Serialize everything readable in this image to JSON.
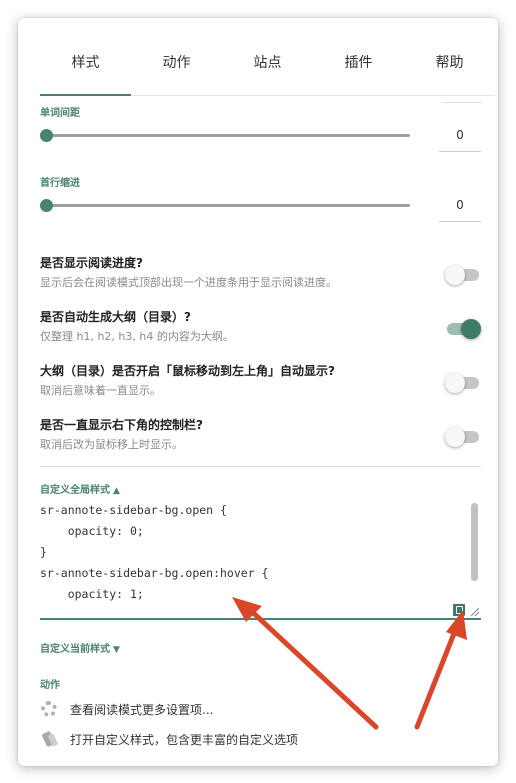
{
  "tabs": [
    {
      "label": "样式",
      "active": true
    },
    {
      "label": "动作",
      "active": false
    },
    {
      "label": "站点",
      "active": false
    },
    {
      "label": "插件",
      "active": false
    },
    {
      "label": "帮助",
      "active": false
    }
  ],
  "sliders": [
    {
      "label": "单词间距",
      "value": "0"
    },
    {
      "label": "首行缩进",
      "value": "0"
    }
  ],
  "toggles": [
    {
      "title": "是否显示阅读进度?",
      "desc": "显示后会在阅读模式顶部出现一个进度条用于显示阅读进度。",
      "on": false
    },
    {
      "title": "是否自动生成大纲（目录）?",
      "desc": "仅整理 h1, h2, h3, h4 的内容为大纲。",
      "on": true
    },
    {
      "title": "大纲（目录）是否开启「鼠标移动到左上角」自动显示?",
      "desc": "取消后意味着一直显示。",
      "on": false
    },
    {
      "title": "是否一直显示右下角的控制栏?",
      "desc": "取消后改为鼠标移上时显示。",
      "on": false
    }
  ],
  "custom_global": {
    "heading": "自定义全局样式",
    "arrow": "▲",
    "code_lines": [
      "sr-annote-sidebar-bg.open {",
      "    opacity: 0;",
      "}",
      "sr-annote-sidebar-bg.open:hover {",
      "    opacity: 1;"
    ]
  },
  "custom_current": {
    "heading": "自定义当前样式",
    "arrow": "▼"
  },
  "actions": {
    "heading": "动作",
    "items": [
      {
        "icon": "gear-icon",
        "label": "查看阅读模式更多设置项..."
      },
      {
        "icon": "brush-icon",
        "label": "打开自定义样式，包含更丰富的自定义选项"
      }
    ]
  },
  "colors": {
    "accent": "#4a8272",
    "annotation_arrow": "#d9462a"
  }
}
